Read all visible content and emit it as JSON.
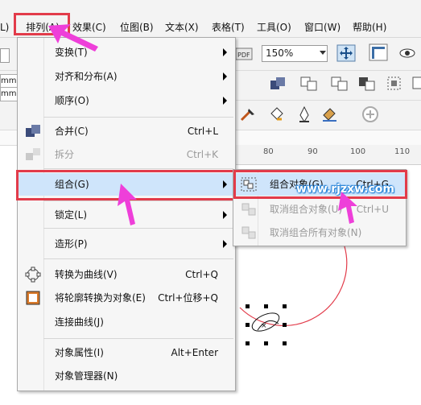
{
  "menubar": {
    "left_cut": "L)",
    "items": [
      "排列(A)",
      "效果(C)",
      "位图(B)",
      "文本(X)",
      "表格(T)",
      "工具(O)",
      "窗口(W)",
      "帮助(H)"
    ]
  },
  "toolbar": {
    "zoom_value": "150%",
    "ruler_ticks": [
      "80",
      "90",
      "100",
      "110"
    ]
  },
  "menu": {
    "items": [
      {
        "label": "变换(T)",
        "shortcut": ""
      },
      {
        "label": "对齐和分布(A)",
        "shortcut": ""
      },
      {
        "label": "顺序(O)",
        "shortcut": ""
      },
      {
        "label": "合并(C)",
        "shortcut": "Ctrl+L"
      },
      {
        "label": "拆分",
        "shortcut": "Ctrl+K"
      },
      {
        "label": "组合(G)",
        "shortcut": ""
      },
      {
        "label": "锁定(L)",
        "shortcut": ""
      },
      {
        "label": "造形(P)",
        "shortcut": ""
      },
      {
        "label": "转换为曲线(V)",
        "shortcut": "Ctrl+Q"
      },
      {
        "label": "将轮廓转换为对象(E)",
        "shortcut": "Ctrl+位移+Q"
      },
      {
        "label": "连接曲线(J)",
        "shortcut": ""
      },
      {
        "label": "对象属性(I)",
        "shortcut": "Alt+Enter"
      },
      {
        "label": "对象管理器(N)",
        "shortcut": ""
      }
    ]
  },
  "submenu": {
    "items": [
      {
        "label": "组合对象(G)",
        "shortcut": "Ctrl+G"
      },
      {
        "label": "取消组合对象(U)",
        "shortcut": "Ctrl+U"
      },
      {
        "label": "取消组合所有对象(N)",
        "shortcut": ""
      }
    ]
  },
  "watermark": "www.rjzxw.com",
  "colors": {
    "highlight_border": "#e23b4a",
    "pointer_arrow": "#ee3fd9",
    "selected_item": "#cfe5fb",
    "circle_outline": "#e23b4a"
  }
}
